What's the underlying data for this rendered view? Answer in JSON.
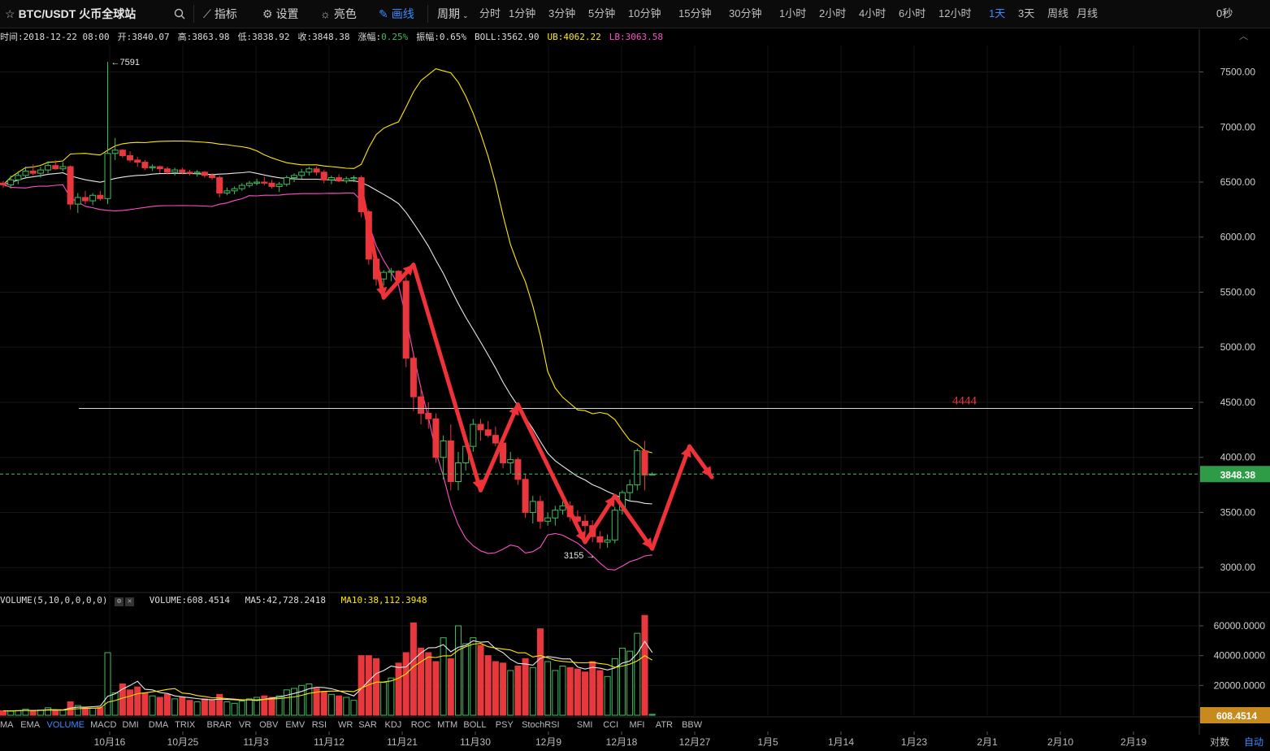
{
  "header": {
    "symbol": "BTC/USDT 火币全球站",
    "indicator_label": "指标",
    "settings_label": "设置",
    "theme_label": "亮色",
    "draw_label": "画线",
    "period_label": "周期",
    "periods": [
      "分时",
      "1分钟",
      "3分钟",
      "5分钟",
      "10分钟",
      "15分钟",
      "30分钟",
      "1小时",
      "2小时",
      "4小时",
      "6小时",
      "12小时",
      "1天",
      "3天",
      "周线",
      "月线"
    ],
    "active_period": "1天",
    "countdown": "0秒"
  },
  "info": {
    "time": "时间:2018-12-22 08:00",
    "open": "开:3840.07",
    "high": "高:3863.98",
    "low": "低:3838.92",
    "close": "收:3848.38",
    "change_label": "涨幅:",
    "change_value": "0.25%",
    "amplitude": "振幅:0.65%",
    "boll": "BOLL:3562.90",
    "ub": "UB:4062.22",
    "lb": "LB:3063.58"
  },
  "volume_info": {
    "name": "VOLUME(5,10,0,0,0,0)",
    "volume": "VOLUME:608.4514",
    "ma5": "MA5:42,728.2418",
    "ma10": "MA10:38,112.3948"
  },
  "price_axis": [
    "7500.00",
    "7000.00",
    "6500.00",
    "6000.00",
    "5500.00",
    "5000.00",
    "4500.00",
    "4000.00",
    "3500.00",
    "3000.00"
  ],
  "volume_axis": [
    "60000.0000",
    "40000.0000",
    "20000.0000"
  ],
  "current_price": "3848.38",
  "current_volume": "608.4514",
  "annotations": {
    "high_marker": "7591",
    "low_marker": "3155",
    "hline_label": "4444"
  },
  "indicators": [
    "MA",
    "EMA",
    "VOLUME",
    "MACD",
    "DMI",
    "DMA",
    "TRIX",
    "BRAR",
    "VR",
    "OBV",
    "EMV",
    "RSI",
    "WR",
    "SAR",
    "KDJ",
    "ROC",
    "MTM",
    "BOLL",
    "PSY",
    "StochRSI",
    "SMI",
    "CCI",
    "MFI",
    "ATR",
    "BBW"
  ],
  "active_indicator": "VOLUME",
  "dates": [
    "10月16",
    "10月25",
    "11月3",
    "11月12",
    "11月21",
    "11月30",
    "12月9",
    "12月18",
    "12月27",
    "1月5",
    "1月14",
    "1月23",
    "2月1",
    "2月10",
    "2月19"
  ],
  "scale_buttons": {
    "log": "对数",
    "auto": "自动"
  },
  "colors": {
    "up": "#3fbf5f",
    "down": "#e8383d",
    "ub": "#ffea00",
    "lb": "#ff4fc8",
    "mid": "#e8e8e8",
    "accent": "#3a8bff"
  },
  "chart_data": {
    "type": "candlestick",
    "interval": "1天",
    "candles_ohlcv": [
      [
        6490,
        6510,
        6450,
        6475,
        3000
      ],
      [
        6475,
        6560,
        6440,
        6520,
        2800
      ],
      [
        6520,
        6600,
        6480,
        6560,
        3200
      ],
      [
        6560,
        6640,
        6530,
        6600,
        4000
      ],
      [
        6600,
        6660,
        6560,
        6580,
        2900
      ],
      [
        6580,
        6640,
        6540,
        6610,
        3500
      ],
      [
        6610,
        6690,
        6580,
        6650,
        5000
      ],
      [
        6650,
        6700,
        6610,
        6620,
        3100
      ],
      [
        6620,
        6680,
        6600,
        6640,
        3400
      ],
      [
        6640,
        6650,
        6250,
        6300,
        9000
      ],
      [
        6300,
        6400,
        6220,
        6360,
        6500
      ],
      [
        6360,
        6420,
        6300,
        6330,
        5000
      ],
      [
        6330,
        6400,
        6290,
        6380,
        4800
      ],
      [
        6380,
        6420,
        6330,
        6350,
        5200
      ],
      [
        6350,
        7591,
        6300,
        6760,
        42000
      ],
      [
        6760,
        6900,
        6700,
        6790,
        15000
      ],
      [
        6790,
        6800,
        6720,
        6740,
        21000
      ],
      [
        6740,
        6780,
        6680,
        6700,
        17000
      ],
      [
        6700,
        6730,
        6640,
        6680,
        19000
      ],
      [
        6680,
        6700,
        6610,
        6630,
        15000
      ],
      [
        6630,
        6660,
        6600,
        6640,
        13000
      ],
      [
        6640,
        6650,
        6580,
        6620,
        12000
      ],
      [
        6620,
        6640,
        6570,
        6590,
        14000
      ],
      [
        6590,
        6630,
        6560,
        6610,
        11000
      ],
      [
        6610,
        6630,
        6570,
        6590,
        12000
      ],
      [
        6590,
        6610,
        6560,
        6580,
        10000
      ],
      [
        6580,
        6610,
        6550,
        6590,
        9000
      ],
      [
        6590,
        6600,
        6540,
        6560,
        11000
      ],
      [
        6560,
        6580,
        6520,
        6540,
        10000
      ],
      [
        6540,
        6560,
        6360,
        6400,
        14000
      ],
      [
        6400,
        6450,
        6380,
        6420,
        9000
      ],
      [
        6420,
        6460,
        6390,
        6440,
        8000
      ],
      [
        6440,
        6490,
        6420,
        6470,
        9500
      ],
      [
        6470,
        6510,
        6450,
        6490,
        11000
      ],
      [
        6490,
        6530,
        6470,
        6500,
        12000
      ],
      [
        6500,
        6550,
        6470,
        6490,
        13000
      ],
      [
        6490,
        6520,
        6440,
        6460,
        12000
      ],
      [
        6460,
        6500,
        6410,
        6480,
        13000
      ],
      [
        6480,
        6560,
        6460,
        6540,
        17000
      ],
      [
        6540,
        6580,
        6500,
        6560,
        18000
      ],
      [
        6560,
        6620,
        6530,
        6590,
        20000
      ],
      [
        6590,
        6640,
        6560,
        6620,
        21000
      ],
      [
        6620,
        6640,
        6560,
        6590,
        18000
      ],
      [
        6590,
        6610,
        6490,
        6520,
        16000
      ],
      [
        6520,
        6560,
        6480,
        6540,
        14000
      ],
      [
        6540,
        6570,
        6500,
        6510,
        13000
      ],
      [
        6510,
        6550,
        6490,
        6530,
        12000
      ],
      [
        6530,
        6560,
        6500,
        6540,
        10000
      ],
      [
        6540,
        6560,
        6180,
        6230,
        40000
      ],
      [
        6230,
        6250,
        5750,
        5800,
        40000
      ],
      [
        5800,
        5850,
        5560,
        5620,
        38000
      ],
      [
        5620,
        5700,
        5560,
        5680,
        22000
      ],
      [
        5680,
        5720,
        5600,
        5690,
        25000
      ],
      [
        5690,
        5700,
        5580,
        5600,
        35000
      ],
      [
        5600,
        5640,
        4820,
        4900,
        42000
      ],
      [
        4900,
        4950,
        4420,
        4550,
        62000
      ],
      [
        4550,
        4650,
        4300,
        4400,
        45000
      ],
      [
        4400,
        4500,
        4260,
        4350,
        42000
      ],
      [
        4350,
        4400,
        3950,
        4000,
        36000
      ],
      [
        4000,
        4200,
        3800,
        4150,
        52000
      ],
      [
        4150,
        4300,
        3700,
        3780,
        38000
      ],
      [
        3780,
        4050,
        3700,
        3950,
        60000
      ],
      [
        3950,
        4150,
        3880,
        4100,
        48000
      ],
      [
        4100,
        4350,
        4050,
        4300,
        52000
      ],
      [
        4300,
        4350,
        4150,
        4250,
        47000
      ],
      [
        4250,
        4330,
        4180,
        4200,
        40000
      ],
      [
        4200,
        4280,
        4100,
        4130,
        36000
      ],
      [
        4130,
        4200,
        3900,
        3950,
        35000
      ],
      [
        3950,
        4050,
        3850,
        3980,
        30000
      ],
      [
        3980,
        4000,
        3750,
        3800,
        33000
      ],
      [
        3800,
        3850,
        3450,
        3500,
        38000
      ],
      [
        3500,
        3650,
        3400,
        3600,
        32000
      ],
      [
        3600,
        3650,
        3350,
        3420,
        58000
      ],
      [
        3420,
        3500,
        3380,
        3450,
        36000
      ],
      [
        3450,
        3560,
        3380,
        3520,
        30000
      ],
      [
        3520,
        3600,
        3480,
        3560,
        33000
      ],
      [
        3560,
        3600,
        3420,
        3460,
        32000
      ],
      [
        3460,
        3520,
        3380,
        3420,
        31000
      ],
      [
        3420,
        3480,
        3320,
        3380,
        29000
      ],
      [
        3380,
        3430,
        3230,
        3280,
        36000
      ],
      [
        3280,
        3330,
        3170,
        3230,
        30000
      ],
      [
        3230,
        3300,
        3180,
        3250,
        26000
      ],
      [
        3250,
        3550,
        3220,
        3520,
        38000
      ],
      [
        3520,
        3700,
        3480,
        3680,
        45000
      ],
      [
        3680,
        3800,
        3600,
        3750,
        43000
      ],
      [
        3750,
        4080,
        3700,
        4060,
        55000
      ],
      [
        4060,
        4150,
        3700,
        3840,
        67000
      ],
      [
        3840,
        3864,
        3839,
        3848,
        608
      ]
    ]
  }
}
